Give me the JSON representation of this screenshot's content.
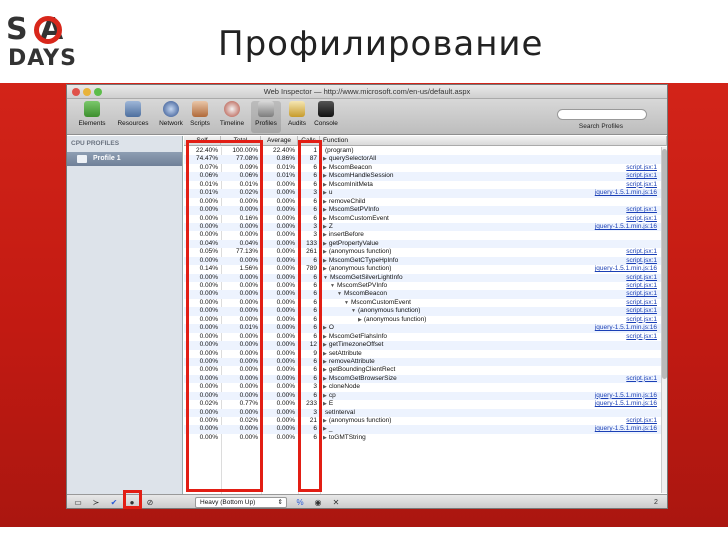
{
  "slide": {
    "title": "Профилирование",
    "logo_top": "S A",
    "logo_bottom": "DAYS",
    "accent": "#d8271b"
  },
  "window": {
    "title": "Web Inspector — http://www.microsoft.com/en-us/default.aspx",
    "toolbar": [
      {
        "label": "Elements",
        "icon": "elements-icon"
      },
      {
        "label": "Resources",
        "icon": "resources-icon"
      },
      {
        "label": "Network",
        "icon": "network-icon"
      },
      {
        "label": "Scripts",
        "icon": "scripts-icon"
      },
      {
        "label": "Timeline",
        "icon": "timeline-icon"
      },
      {
        "label": "Profiles",
        "icon": "profiles-icon"
      },
      {
        "label": "Audits",
        "icon": "audits-icon"
      },
      {
        "label": "Console",
        "icon": "console-icon"
      }
    ],
    "search_label": "Search Profiles"
  },
  "sidebar": {
    "header": "CPU PROFILES",
    "profile": "Profile 1"
  },
  "table": {
    "columns": [
      "Self",
      "Total",
      "Average",
      "Calls",
      "Function"
    ],
    "rows": [
      {
        "self": "22.40%",
        "total": "100.00%",
        "avg": "22.40%",
        "calls": "1",
        "fn": "(program)",
        "indent": 0,
        "arrow": "",
        "link": ""
      },
      {
        "self": "74.47%",
        "total": "77.08%",
        "avg": "0.86%",
        "calls": "87",
        "fn": "querySelectorAll",
        "indent": 0,
        "arrow": "▶",
        "link": ""
      },
      {
        "self": "0.07%",
        "total": "0.09%",
        "avg": "0.01%",
        "calls": "6",
        "fn": "MscomBeacon",
        "indent": 0,
        "arrow": "▶",
        "link": "script.jsx:1"
      },
      {
        "self": "0.06%",
        "total": "0.06%",
        "avg": "0.01%",
        "calls": "6",
        "fn": "MscomHandleSession",
        "indent": 0,
        "arrow": "▶",
        "link": "script.jsx:1"
      },
      {
        "self": "0.01%",
        "total": "0.01%",
        "avg": "0.00%",
        "calls": "6",
        "fn": "MscomInitMeta",
        "indent": 0,
        "arrow": "▶",
        "link": "script.jsx:1"
      },
      {
        "self": "0.01%",
        "total": "0.02%",
        "avg": "0.00%",
        "calls": "3",
        "fn": "u",
        "indent": 0,
        "arrow": "▶",
        "link": "jquery-1.5.1.min.js:16"
      },
      {
        "self": "0.00%",
        "total": "0.00%",
        "avg": "0.00%",
        "calls": "6",
        "fn": "removeChild",
        "indent": 0,
        "arrow": "▶",
        "link": ""
      },
      {
        "self": "0.00%",
        "total": "0.00%",
        "avg": "0.00%",
        "calls": "6",
        "fn": "MscomSetPVInfo",
        "indent": 0,
        "arrow": "▶",
        "link": "script.jsx:1"
      },
      {
        "self": "0.00%",
        "total": "0.16%",
        "avg": "0.00%",
        "calls": "6",
        "fn": "MscomCustomEvent",
        "indent": 0,
        "arrow": "▶",
        "link": "script.jsx:1"
      },
      {
        "self": "0.00%",
        "total": "0.00%",
        "avg": "0.00%",
        "calls": "3",
        "fn": "Z",
        "indent": 0,
        "arrow": "▶",
        "link": "jquery-1.5.1.min.js:16"
      },
      {
        "self": "0.00%",
        "total": "0.00%",
        "avg": "0.00%",
        "calls": "3",
        "fn": "insertBefore",
        "indent": 0,
        "arrow": "▶",
        "link": ""
      },
      {
        "self": "0.04%",
        "total": "0.04%",
        "avg": "0.00%",
        "calls": "133",
        "fn": "getPropertyValue",
        "indent": 0,
        "arrow": "▶",
        "link": ""
      },
      {
        "self": "0.05%",
        "total": "77.13%",
        "avg": "0.00%",
        "calls": "261",
        "fn": "(anonymous function)",
        "indent": 0,
        "arrow": "▶",
        "link": "script.jsx:1"
      },
      {
        "self": "0.00%",
        "total": "0.00%",
        "avg": "0.00%",
        "calls": "6",
        "fn": "MscomGetCTypeHpInfo",
        "indent": 0,
        "arrow": "▶",
        "link": "script.jsx:1"
      },
      {
        "self": "0.14%",
        "total": "1.56%",
        "avg": "0.00%",
        "calls": "789",
        "fn": "(anonymous function)",
        "indent": 0,
        "arrow": "▶",
        "link": "jquery-1.5.1.min.js:16"
      },
      {
        "self": "0.00%",
        "total": "0.00%",
        "avg": "0.00%",
        "calls": "6",
        "fn": "MscomGetSilverLightInfo",
        "indent": 0,
        "arrow": "▼",
        "link": "script.jsx:1"
      },
      {
        "self": "0.00%",
        "total": "0.00%",
        "avg": "0.00%",
        "calls": "6",
        "fn": "MscomSetPVInfo",
        "indent": 1,
        "arrow": "▼",
        "link": "script.jsx:1"
      },
      {
        "self": "0.00%",
        "total": "0.00%",
        "avg": "0.00%",
        "calls": "6",
        "fn": "MscomBeacon",
        "indent": 2,
        "arrow": "▼",
        "link": "script.jsx:1"
      },
      {
        "self": "0.00%",
        "total": "0.00%",
        "avg": "0.00%",
        "calls": "6",
        "fn": "MscomCustomEvent",
        "indent": 3,
        "arrow": "▼",
        "link": "script.jsx:1"
      },
      {
        "self": "0.00%",
        "total": "0.00%",
        "avg": "0.00%",
        "calls": "6",
        "fn": "(anonymous function)",
        "indent": 4,
        "arrow": "▼",
        "link": "script.jsx:1"
      },
      {
        "self": "0.00%",
        "total": "0.00%",
        "avg": "0.00%",
        "calls": "6",
        "fn": "(anonymous function)",
        "indent": 5,
        "arrow": "▶",
        "link": "script.jsx:1"
      },
      {
        "self": "0.00%",
        "total": "0.01%",
        "avg": "0.00%",
        "calls": "6",
        "fn": "O",
        "indent": 0,
        "arrow": "▶",
        "link": "jquery-1.5.1.min.js:16"
      },
      {
        "self": "0.00%",
        "total": "0.00%",
        "avg": "0.00%",
        "calls": "6",
        "fn": "MscomGetFlahsInfo",
        "indent": 0,
        "arrow": "▶",
        "link": "script.jsx:1"
      },
      {
        "self": "0.00%",
        "total": "0.00%",
        "avg": "0.00%",
        "calls": "12",
        "fn": "getTimezoneOffset",
        "indent": 0,
        "arrow": "▶",
        "link": ""
      },
      {
        "self": "0.00%",
        "total": "0.00%",
        "avg": "0.00%",
        "calls": "9",
        "fn": "setAttribute",
        "indent": 0,
        "arrow": "▶",
        "link": ""
      },
      {
        "self": "0.00%",
        "total": "0.00%",
        "avg": "0.00%",
        "calls": "6",
        "fn": "removeAttribute",
        "indent": 0,
        "arrow": "▶",
        "link": ""
      },
      {
        "self": "0.00%",
        "total": "0.00%",
        "avg": "0.00%",
        "calls": "6",
        "fn": "getBoundingClientRect",
        "indent": 0,
        "arrow": "▶",
        "link": ""
      },
      {
        "self": "0.00%",
        "total": "0.00%",
        "avg": "0.00%",
        "calls": "6",
        "fn": "MscomGetBrowserSize",
        "indent": 0,
        "arrow": "▶",
        "link": "script.jsx:1"
      },
      {
        "self": "0.00%",
        "total": "0.00%",
        "avg": "0.00%",
        "calls": "3",
        "fn": "cloneNode",
        "indent": 0,
        "arrow": "▶",
        "link": ""
      },
      {
        "self": "0.00%",
        "total": "0.00%",
        "avg": "0.00%",
        "calls": "6",
        "fn": "cp",
        "indent": 0,
        "arrow": "▶",
        "link": "jquery-1.5.1.min.js:16"
      },
      {
        "self": "0.02%",
        "total": "0.77%",
        "avg": "0.00%",
        "calls": "233",
        "fn": "E",
        "indent": 0,
        "arrow": "▶",
        "link": "jquery-1.5.1.min.js:16"
      },
      {
        "self": "0.00%",
        "total": "0.00%",
        "avg": "0.00%",
        "calls": "3",
        "fn": "setInterval",
        "indent": 0,
        "arrow": "",
        "link": ""
      },
      {
        "self": "0.00%",
        "total": "0.02%",
        "avg": "0.00%",
        "calls": "21",
        "fn": "(anonymous function)",
        "indent": 0,
        "arrow": "▶",
        "link": "script.jsx:1"
      },
      {
        "self": "0.00%",
        "total": "0.00%",
        "avg": "0.00%",
        "calls": "6",
        "fn": "_",
        "indent": 0,
        "arrow": "▶",
        "link": "jquery-1.5.1.min.js:16"
      },
      {
        "self": "0.00%",
        "total": "0.00%",
        "avg": "0.00%",
        "calls": "6",
        "fn": "toGMTString",
        "indent": 0,
        "arrow": "▶",
        "link": ""
      }
    ]
  },
  "statusbar": {
    "view_mode": "Heavy (Bottom Up)",
    "percent_toggle": "%",
    "page_number": "2"
  }
}
